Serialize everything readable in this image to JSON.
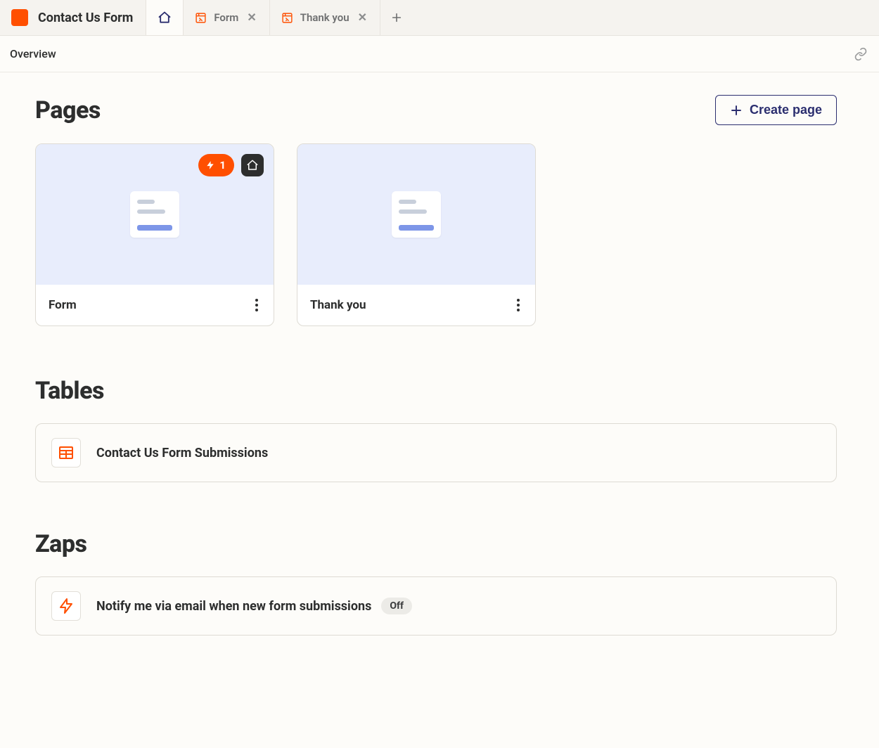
{
  "app": {
    "title": "Contact Us Form"
  },
  "tabs": {
    "form": "Form",
    "thankyou": "Thank you"
  },
  "subheader": {
    "title": "Overview"
  },
  "sections": {
    "pages": {
      "title": "Pages",
      "create_label": "Create page",
      "cards": [
        {
          "name": "Form",
          "zap_count": "1",
          "is_home": true
        },
        {
          "name": "Thank you",
          "is_home": false
        }
      ]
    },
    "tables": {
      "title": "Tables",
      "items": [
        {
          "name": "Contact Us Form Submissions"
        }
      ]
    },
    "zaps": {
      "title": "Zaps",
      "items": [
        {
          "name": "Notify me via email when new form submissions",
          "status": "Off"
        }
      ]
    }
  }
}
